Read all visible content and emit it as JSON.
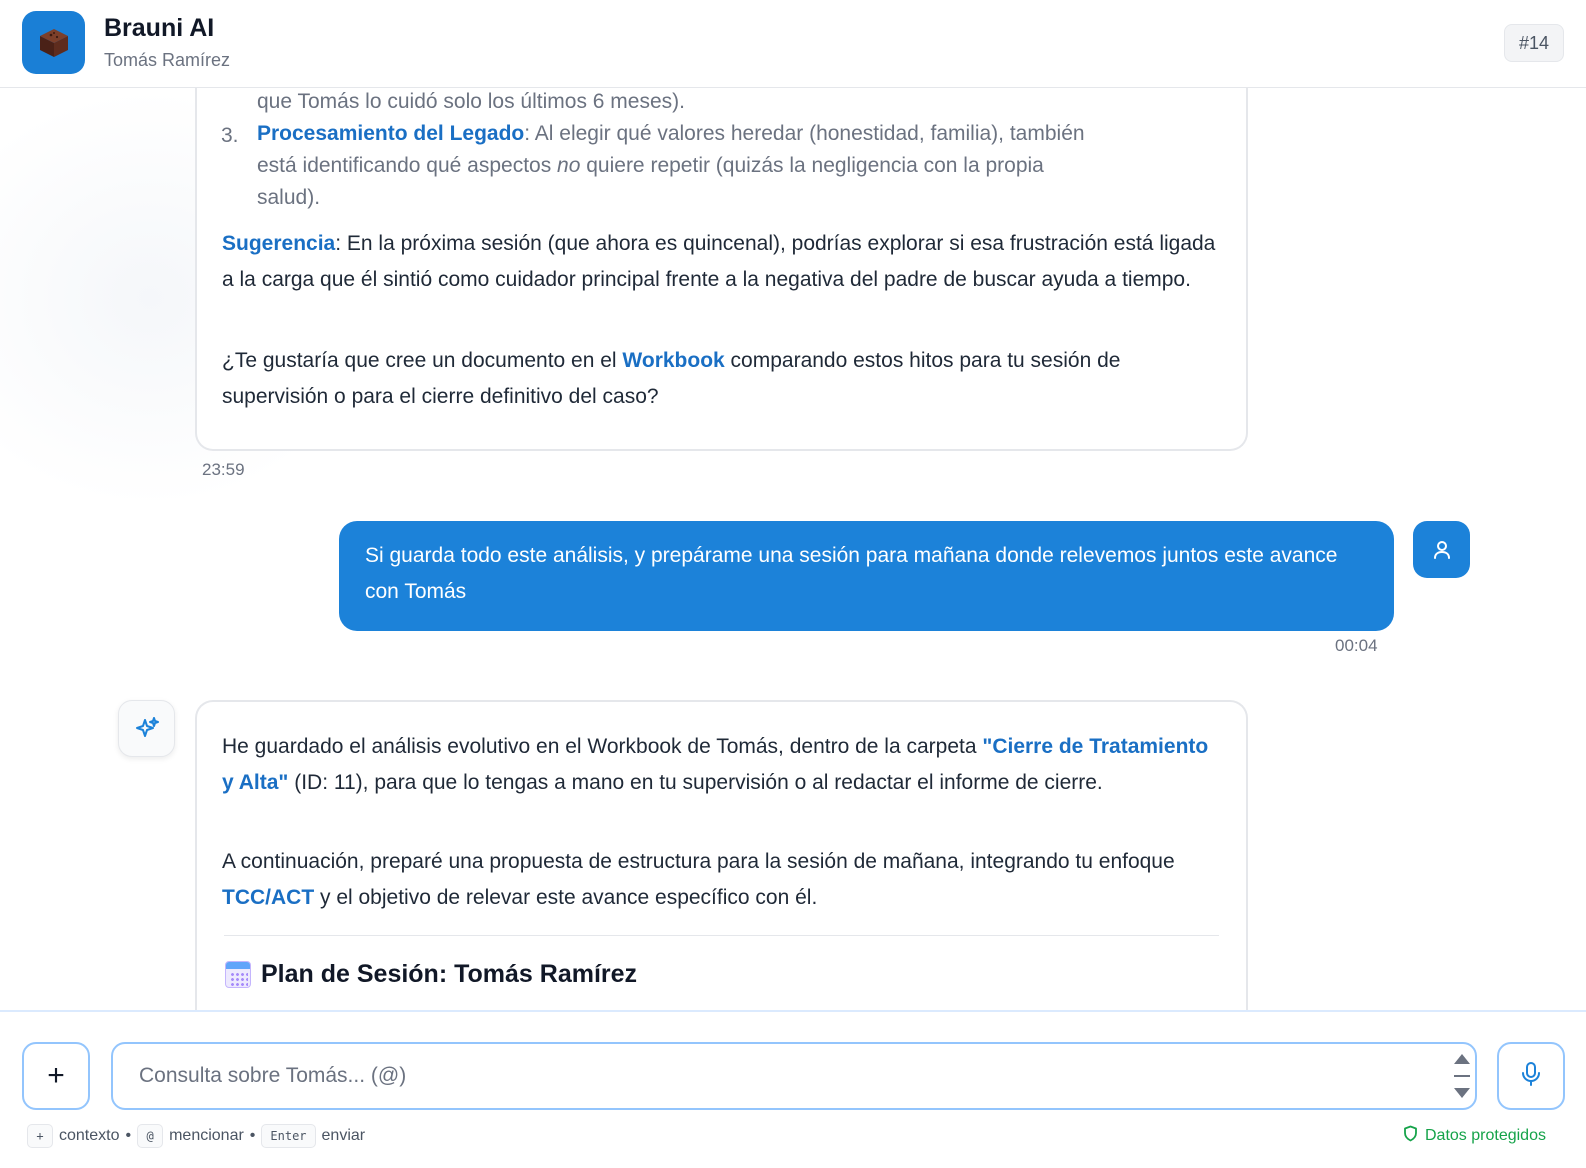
{
  "header": {
    "title": "Brauni AI",
    "subtitle": "Tomás Ramírez",
    "badge": "#14",
    "accent_color": "#1a7fd6"
  },
  "messages": {
    "ai_prev": {
      "line_tail": "que Tomás lo cuidó solo los últimos 6 meses).",
      "item3_num": "3.",
      "item3_title": "Procesamiento del Legado",
      "item3_line1": ": Al elegir qué valores heredar (honestidad, familia), también",
      "item3_line2a": "está identificando qué aspectos ",
      "item3_line2_em": "no",
      "item3_line2b": " quiere repetir (quizás la negligencia con la propia",
      "item3_line3": "salud).",
      "suggest_title": "Sugerencia",
      "suggest_text": ": En la próxima sesión (que ahora es quincenal), podrías explorar si esa frustración está ligada a la carga que él sintió como cuidador principal frente a la negativa del padre de buscar ayuda a tiempo.",
      "question_a": "¿Te gustaría que cree un documento en el ",
      "question_link": "Workbook",
      "question_b": " comparando estos hitos para tu sesión de supervisión o para el cierre definitivo del caso?",
      "time": "23:59"
    },
    "user": {
      "text": "Si guarda todo este análisis, y prepárame una sesión para mañana donde relevemos juntos este avance con Tomás",
      "time": "00:04"
    },
    "ai_reply": {
      "p1a": "He guardado el análisis evolutivo en el Workbook de Tomás, dentro de la carpeta ",
      "p1_link": "\"Cierre de Tratamiento y Alta\"",
      "p1b": " (ID: 11), para que lo tengas a mano en tu supervisión o al redactar el informe de cierre.",
      "p2a": "A continuación, preparé una propuesta de estructura para la sesión de mañana, integrando tu enfoque ",
      "p2_link": "TCC/ACT",
      "p2b": " y el objetivo de relevar este avance específico con él.",
      "plan_title": "Plan de Sesión: Tomás Ramírez"
    }
  },
  "composer": {
    "add_label": "+",
    "placeholder": "Consulta sobre Tomás... (@)",
    "hint_plus_key": "+",
    "hint_plus": "contexto",
    "hint_at_key": "@",
    "hint_at": "mencionar",
    "hint_enter_key": "Enter",
    "hint_enter": "enviar",
    "separator": "•",
    "protected": "Datos protegidos"
  },
  "icons": {
    "app": "brownie-icon",
    "user": "user-icon",
    "ai": "sparkle-icon",
    "mic": "microphone-icon",
    "shield": "shield-icon",
    "calendar": "calendar-icon"
  }
}
